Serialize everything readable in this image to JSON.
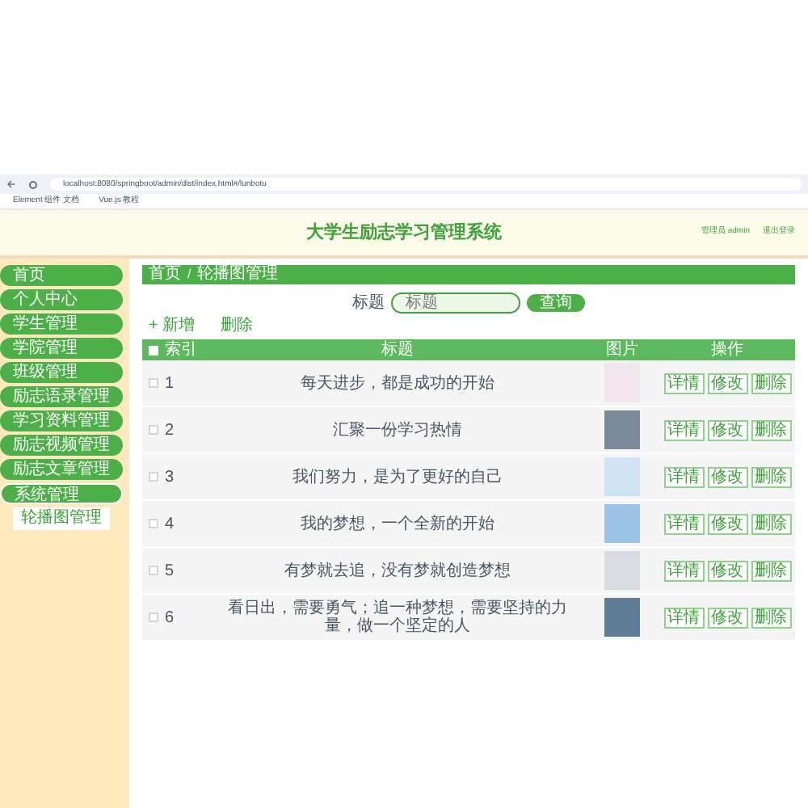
{
  "browser": {
    "url": "localhost:8080/springboot/admin/dist/index.html#/lunbotu",
    "bookmarks": [
      "Element 组件 文档",
      "Vue.js 教程"
    ]
  },
  "header": {
    "title": "大学生励志学习管理系统",
    "user": "管理员 admin",
    "logout": "退出登录"
  },
  "sidebar": {
    "items": [
      {
        "label": "首页",
        "selected": false,
        "expanded": false
      },
      {
        "label": "个人中心",
        "selected": false,
        "expanded": false
      },
      {
        "label": "学生管理",
        "selected": false,
        "expanded": false
      },
      {
        "label": "学院管理",
        "selected": false,
        "expanded": false
      },
      {
        "label": "班级管理",
        "selected": false,
        "expanded": false
      },
      {
        "label": "励志语录管理",
        "selected": false,
        "expanded": false
      },
      {
        "label": "学习资料管理",
        "selected": false,
        "expanded": false
      },
      {
        "label": "励志视频管理",
        "selected": false,
        "expanded": false
      },
      {
        "label": "励志文章管理",
        "selected": false,
        "expanded": false
      },
      {
        "label": "系统管理",
        "selected": false,
        "expanded": true,
        "children": [
          {
            "label": "轮播图管理",
            "selected": true
          }
        ]
      }
    ]
  },
  "breadcrumb": {
    "items": [
      "首页",
      "轮播图管理"
    ],
    "separator": "/"
  },
  "search": {
    "label": "标题",
    "placeholder": "标题",
    "button": "查询"
  },
  "actions": [
    "+ 新增",
    "删除"
  ],
  "table": {
    "select_all_checked": false,
    "columns": [
      "索引",
      "标题",
      "图片",
      "操作"
    ],
    "rows": [
      {
        "checked": false,
        "index": "1",
        "title": "每天进步，都是成功的开始",
        "buttons": [
          "详情",
          "修改",
          "删除"
        ]
      },
      {
        "checked": false,
        "index": "2",
        "title": "汇聚一份学习热情",
        "buttons": [
          "详情",
          "修改",
          "删除"
        ]
      },
      {
        "checked": false,
        "index": "3",
        "title": "我们努力，是为了更好的自己",
        "buttons": [
          "详情",
          "修改",
          "删除"
        ]
      },
      {
        "checked": false,
        "index": "4",
        "title": "我的梦想，一个全新的开始",
        "buttons": [
          "详情",
          "修改",
          "删除"
        ]
      },
      {
        "checked": false,
        "index": "5",
        "title": "有梦就去追，没有梦就创造梦想",
        "buttons": [
          "详情",
          "修改",
          "删除"
        ]
      },
      {
        "checked": false,
        "index": "6",
        "title": "看日出，需要勇气；追一种梦想，需要坚持的力量，做一个坚定的人",
        "buttons": [
          "详情",
          "修改",
          "删除"
        ]
      }
    ]
  }
}
